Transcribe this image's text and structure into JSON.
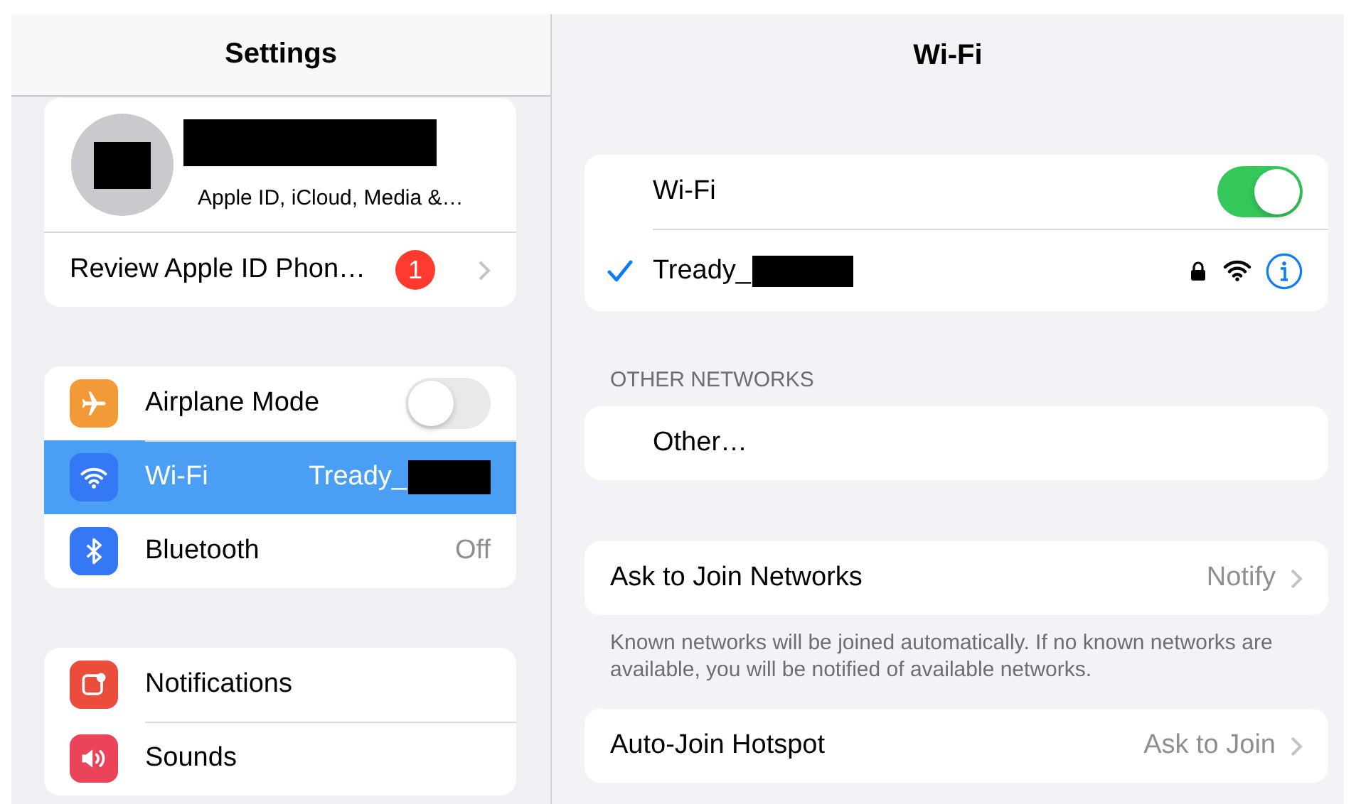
{
  "sidebar": {
    "title": "Settings",
    "profile": {
      "subtitle": "Apple ID, iCloud, Media &…"
    },
    "review": {
      "label": "Review Apple ID Phon…",
      "badge": "1"
    },
    "groups": [
      {
        "items": [
          {
            "kind": "toggle",
            "label": "Airplane Mode",
            "on": false,
            "selected": false,
            "color": "#f19a37"
          },
          {
            "kind": "value",
            "label": "Wi-Fi",
            "value": "Tready_",
            "redacted": true,
            "selected": true,
            "color": "#3478f6"
          },
          {
            "kind": "value",
            "label": "Bluetooth",
            "value": "Off",
            "redacted": false,
            "selected": false,
            "color": "#3478f6"
          }
        ]
      },
      {
        "items": [
          {
            "kind": "plain",
            "label": "Notifications",
            "selected": false,
            "color": "#eb4d3d"
          },
          {
            "kind": "plain",
            "label": "Sounds",
            "selected": false,
            "color": "#eb445a"
          }
        ]
      }
    ]
  },
  "main": {
    "title": "Wi-Fi",
    "wifi": {
      "label": "Wi-Fi",
      "on": true
    },
    "network": {
      "name": "Tready_",
      "connected": true
    },
    "other_header": "OTHER NETWORKS",
    "other": "Other…",
    "ask": {
      "label": "Ask to Join Networks",
      "value": "Notify"
    },
    "ask_footer": "Known networks will be joined automatically. If no known networks are available, you will be notified of available networks.",
    "hotspot": {
      "label": "Auto-Join Hotspot",
      "value": "Ask to Join"
    }
  }
}
